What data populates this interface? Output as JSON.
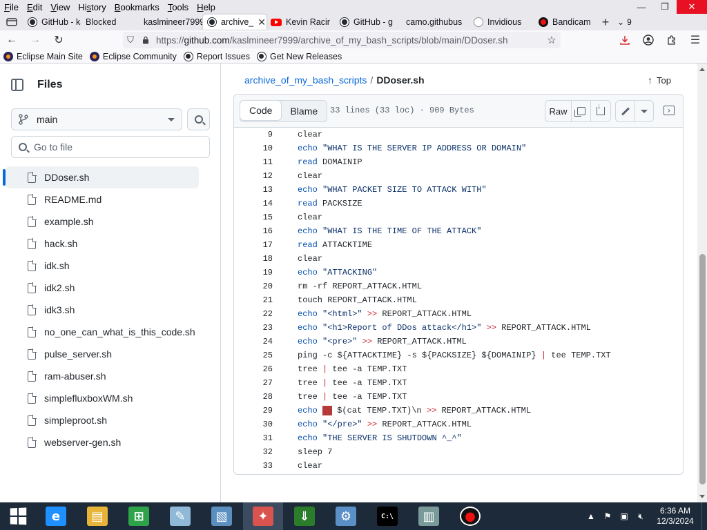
{
  "menubar": {
    "items": [
      "File",
      "Edit",
      "View",
      "History",
      "Bookmarks",
      "Tools",
      "Help"
    ],
    "underline_letters": [
      "F",
      "E",
      "V",
      "s",
      "B",
      "T",
      "H"
    ]
  },
  "tabs": [
    {
      "label": "GitHub - ka",
      "icon": "github"
    },
    {
      "label": "Blocked",
      "icon": "none"
    },
    {
      "label": "kaslmineer7999",
      "icon": "none"
    },
    {
      "label": "archive_",
      "icon": "github",
      "active": true
    },
    {
      "label": "Kevin Racir",
      "icon": "youtube"
    },
    {
      "label": "GitHub - g",
      "icon": "github"
    },
    {
      "label": "camo.githubus",
      "icon": "none"
    },
    {
      "label": "Invidious",
      "icon": "invidious"
    },
    {
      "label": "Bandicam",
      "icon": "record"
    }
  ],
  "tab_overflow_count": "9",
  "url": {
    "scheme": "https://",
    "domain": "github.com",
    "path": "/kaslmineer7999/archive_of_my_bash_scripts/blob/main/DDoser.sh"
  },
  "bookmarks": [
    {
      "label": "Eclipse Main Site",
      "icon": "eclipse"
    },
    {
      "label": "Eclipse Community",
      "icon": "eclipse"
    },
    {
      "label": "Report Issues",
      "icon": "github"
    },
    {
      "label": "Get New Releases",
      "icon": "github"
    }
  ],
  "sidebar": {
    "title": "Files",
    "branch": "main",
    "goto_placeholder": "Go to file",
    "files": [
      {
        "name": "DDoser.sh",
        "active": true
      },
      {
        "name": "README.md"
      },
      {
        "name": "example.sh"
      },
      {
        "name": "hack.sh"
      },
      {
        "name": "idk.sh"
      },
      {
        "name": "idk2.sh"
      },
      {
        "name": "idk3.sh"
      },
      {
        "name": "no_one_can_what_is_this_code.sh"
      },
      {
        "name": "pulse_server.sh"
      },
      {
        "name": "ram-abuser.sh"
      },
      {
        "name": "simplefluxboxWM.sh"
      },
      {
        "name": "simpleproot.sh"
      },
      {
        "name": "webserver-gen.sh"
      }
    ]
  },
  "breadcrumb": {
    "repo": "archive_of_my_bash_scripts",
    "separator": "/",
    "file": "DDoser.sh"
  },
  "top_link": "Top",
  "code_header": {
    "tab_code": "Code",
    "tab_blame": "Blame",
    "info": "33 lines (33 loc) · 909 Bytes",
    "raw": "Raw"
  },
  "code_lines": [
    {
      "n": "9",
      "tokens": [
        {
          "t": "clear",
          "c": ""
        }
      ]
    },
    {
      "n": "10",
      "tokens": [
        {
          "t": "echo",
          "c": "kw"
        },
        {
          "t": " ",
          "c": ""
        },
        {
          "t": "\"WHAT IS THE SERVER IP ADDRESS OR DOMAIN\"",
          "c": "str"
        }
      ]
    },
    {
      "n": "11",
      "tokens": [
        {
          "t": "read",
          "c": "kw"
        },
        {
          "t": " DOMAINIP",
          "c": ""
        }
      ]
    },
    {
      "n": "12",
      "tokens": [
        {
          "t": "clear",
          "c": ""
        }
      ]
    },
    {
      "n": "13",
      "tokens": [
        {
          "t": "echo",
          "c": "kw"
        },
        {
          "t": " ",
          "c": ""
        },
        {
          "t": "\"WHAT PACKET SIZE TO ATTACK WITH\"",
          "c": "str"
        }
      ]
    },
    {
      "n": "14",
      "tokens": [
        {
          "t": "read",
          "c": "kw"
        },
        {
          "t": " PACKSIZE",
          "c": ""
        }
      ]
    },
    {
      "n": "15",
      "tokens": [
        {
          "t": "clear",
          "c": ""
        }
      ]
    },
    {
      "n": "16",
      "tokens": [
        {
          "t": "echo",
          "c": "kw"
        },
        {
          "t": " ",
          "c": ""
        },
        {
          "t": "\"WHAT IS THE TIME OF THE ATTACK\"",
          "c": "str"
        }
      ]
    },
    {
      "n": "17",
      "tokens": [
        {
          "t": "read",
          "c": "kw"
        },
        {
          "t": " ATTACKTIME",
          "c": ""
        }
      ]
    },
    {
      "n": "18",
      "tokens": [
        {
          "t": "clear",
          "c": ""
        }
      ]
    },
    {
      "n": "19",
      "tokens": [
        {
          "t": "echo",
          "c": "kw"
        },
        {
          "t": " ",
          "c": ""
        },
        {
          "t": "\"ATTACKING\"",
          "c": "str"
        }
      ]
    },
    {
      "n": "20",
      "tokens": [
        {
          "t": "rm -rf REPORT_ATTACK.HTML",
          "c": ""
        }
      ]
    },
    {
      "n": "21",
      "tokens": [
        {
          "t": "touch REPORT_ATTACK.HTML",
          "c": ""
        }
      ]
    },
    {
      "n": "22",
      "tokens": [
        {
          "t": "echo",
          "c": "kw"
        },
        {
          "t": " ",
          "c": ""
        },
        {
          "t": "\"<html>\"",
          "c": "str"
        },
        {
          "t": " ",
          "c": ""
        },
        {
          "t": ">>",
          "c": "op"
        },
        {
          "t": " REPORT_ATTACK.HTML",
          "c": ""
        }
      ]
    },
    {
      "n": "23",
      "tokens": [
        {
          "t": "echo",
          "c": "kw"
        },
        {
          "t": " ",
          "c": ""
        },
        {
          "t": "\"<h1>Report of DDos attack</h1>\"",
          "c": "str"
        },
        {
          "t": " ",
          "c": ""
        },
        {
          "t": ">>",
          "c": "op"
        },
        {
          "t": " REPORT_ATTACK.HTML",
          "c": ""
        }
      ]
    },
    {
      "n": "24",
      "tokens": [
        {
          "t": "echo",
          "c": "kw"
        },
        {
          "t": " ",
          "c": ""
        },
        {
          "t": "\"<pre>\"",
          "c": "str"
        },
        {
          "t": " ",
          "c": ""
        },
        {
          "t": ">>",
          "c": "op"
        },
        {
          "t": " REPORT_ATTACK.HTML",
          "c": ""
        }
      ]
    },
    {
      "n": "25",
      "tokens": [
        {
          "t": "ping -c ${ATTACKTIME} -s ${PACKSIZE} ${DOMAINIP} ",
          "c": ""
        },
        {
          "t": "|",
          "c": "op"
        },
        {
          "t": " tee TEMP.TXT",
          "c": ""
        }
      ]
    },
    {
      "n": "26",
      "tokens": [
        {
          "t": "tree ",
          "c": ""
        },
        {
          "t": "|",
          "c": "op"
        },
        {
          "t": " tee -a TEMP.TXT",
          "c": ""
        }
      ]
    },
    {
      "n": "27",
      "tokens": [
        {
          "t": "tree ",
          "c": ""
        },
        {
          "t": "|",
          "c": "op"
        },
        {
          "t": " tee -a TEMP.TXT",
          "c": ""
        }
      ]
    },
    {
      "n": "28",
      "tokens": [
        {
          "t": "tree ",
          "c": ""
        },
        {
          "t": "|",
          "c": "op"
        },
        {
          "t": " tee -a TEMP.TXT",
          "c": ""
        }
      ]
    },
    {
      "n": "29",
      "tokens": [
        {
          "t": "echo",
          "c": "kw"
        },
        {
          "t": " ",
          "c": ""
        },
        {
          "t": "",
          "c": "cursor"
        },
        {
          "t": " $(cat TEMP.TXT)\\n ",
          "c": ""
        },
        {
          "t": ">>",
          "c": "op"
        },
        {
          "t": " REPORT_ATTACK.HTML",
          "c": ""
        }
      ]
    },
    {
      "n": "30",
      "tokens": [
        {
          "t": "echo",
          "c": "kw"
        },
        {
          "t": " ",
          "c": ""
        },
        {
          "t": "\"</pre>\"",
          "c": "str"
        },
        {
          "t": " ",
          "c": ""
        },
        {
          "t": ">>",
          "c": "op"
        },
        {
          "t": " REPORT_ATTACK.HTML",
          "c": ""
        }
      ]
    },
    {
      "n": "31",
      "tokens": [
        {
          "t": "echo",
          "c": "kw"
        },
        {
          "t": " ",
          "c": ""
        },
        {
          "t": "\"THE SERVER IS SHUTDOWN ^_^\"",
          "c": "str"
        }
      ]
    },
    {
      "n": "32",
      "tokens": [
        {
          "t": "sleep 7",
          "c": ""
        }
      ]
    },
    {
      "n": "33",
      "tokens": [
        {
          "t": "clear",
          "c": ""
        }
      ]
    }
  ],
  "taskbar": {
    "apps": [
      {
        "name": "internet-explorer",
        "glyph": "e",
        "color": "#1e90ff"
      },
      {
        "name": "file-explorer",
        "glyph": "▤",
        "color": "#e8b339"
      },
      {
        "name": "store",
        "glyph": "⊞",
        "color": "#2fa34a"
      },
      {
        "name": "notepad",
        "glyph": "✎",
        "color": "#8fb9d6"
      },
      {
        "name": "photos",
        "glyph": "▧",
        "color": "#5b8fbf"
      },
      {
        "name": "toolbox",
        "glyph": "✦",
        "color": "#d9534f",
        "active": true
      },
      {
        "name": "downloader",
        "glyph": "⇓",
        "color": "#2b7d2b"
      },
      {
        "name": "control-panel",
        "glyph": "⚙",
        "color": "#5a8fc7"
      },
      {
        "name": "command-prompt",
        "glyph": "C:\\",
        "color": "#000000"
      },
      {
        "name": "text-document",
        "glyph": "▥",
        "color": "#7a9a9a"
      },
      {
        "name": "bandicam-record",
        "glyph": "●",
        "color": "#111111"
      }
    ],
    "time": "6:36 AM",
    "date": "12/3/2024"
  },
  "colors": {
    "link_blue": "#0969da",
    "keyword": "#0550ae",
    "string": "#0a3069",
    "operator": "#cf222e",
    "close_button": "#e81123",
    "taskbar": "#1d2a39"
  }
}
